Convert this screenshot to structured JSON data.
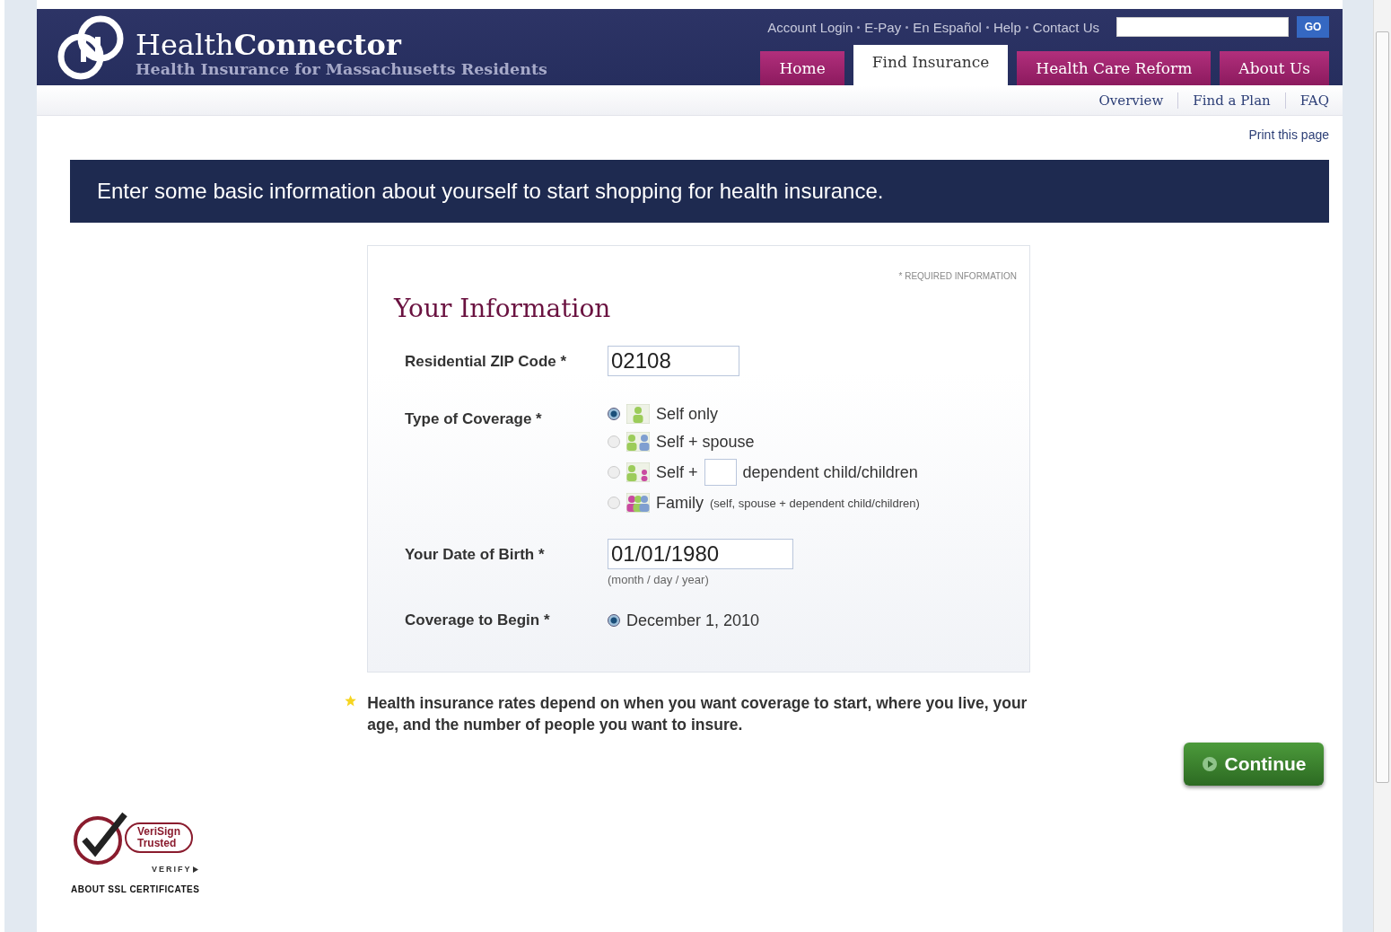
{
  "header": {
    "logo_text": "Health**Connector**",
    "tagline": "Health Insurance for Massachusetts Residents",
    "top_links": [
      "Account Login",
      "E-Pay",
      "En Español",
      "Help",
      "Contact Us"
    ],
    "search": {
      "button": "GO"
    },
    "tabs": [
      {
        "label": "Home",
        "selected": false
      },
      {
        "label": "Find Insurance",
        "selected": true
      },
      {
        "label": "Health Care Reform",
        "selected": false
      },
      {
        "label": "About Us",
        "selected": false
      }
    ]
  },
  "subnav": [
    "Overview",
    "Find a Plan",
    "FAQ"
  ],
  "print_link": "Print this page",
  "banner": "Enter some basic information about yourself to start shopping for health insurance.",
  "form": {
    "required_note": "* REQUIRED INFORMATION",
    "title": "Your Information",
    "zip": {
      "label": "Residential ZIP Code *",
      "value": "02108"
    },
    "coverage": {
      "label": "Type of Coverage *",
      "options": [
        {
          "kind": "self",
          "label": "Self only",
          "selected": true
        },
        {
          "kind": "spouse",
          "label": "Self + spouse",
          "selected": false
        },
        {
          "kind": "dependents",
          "label": "Self +",
          "label_after": "dependent child/children",
          "selected": false
        },
        {
          "kind": "family",
          "label": "Family",
          "note": "(self, spouse + dependent child/children)",
          "selected": false
        }
      ]
    },
    "dob": {
      "label": "Your Date of Birth *",
      "value": "01/01/1980",
      "hint": "(month / day / year)"
    },
    "start": {
      "label": "Coverage to Begin *",
      "options": [
        {
          "label": "December 1, 2010",
          "selected": true
        }
      ]
    }
  },
  "note": "Health insurance rates depend on when you want coverage to start, where you live, your age, and the number of people you want to insure.",
  "continue_button": "Continue",
  "seal": {
    "line_1": "VeriSign",
    "line_2": "Trusted",
    "verify": "VERIFY",
    "caption": "ABOUT SSL CERTIFICATES"
  }
}
